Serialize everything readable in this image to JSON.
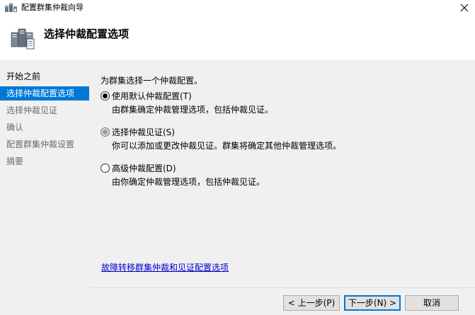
{
  "window": {
    "title": "配置群集仲裁向导",
    "close_glyph": "✕"
  },
  "header": {
    "heading": "选择仲裁配置选项"
  },
  "sidebar": {
    "items": [
      {
        "label": "开始之前",
        "state": "done"
      },
      {
        "label": "选择仲裁配置选项",
        "state": "active"
      },
      {
        "label": "选择仲裁见证",
        "state": "pending"
      },
      {
        "label": "确认",
        "state": "pending"
      },
      {
        "label": "配置群集仲裁设置",
        "state": "pending"
      },
      {
        "label": "摘要",
        "state": "pending"
      }
    ]
  },
  "main": {
    "prompt": "为群集选择一个仲裁配置。",
    "options": [
      {
        "label": "使用默认仲裁配置(T)",
        "description": "由群集确定仲裁管理选项，包括仲裁见证。",
        "selected": true
      },
      {
        "label": "选择仲裁见证(S)",
        "description": "你可以添加或更改仲裁见证。群集将确定其他仲裁管理选项。",
        "selected": false
      },
      {
        "label": "高级仲裁配置(D)",
        "description": "由你确定仲裁管理选项，包括仲裁见证。",
        "selected": false
      }
    ],
    "link": "故障转移群集仲裁和见证配置选项"
  },
  "footer": {
    "back_label": "< 上一步(P)",
    "next_label": "下一步(N) >",
    "cancel_label": "取消"
  },
  "colors": {
    "accent": "#0078d7",
    "link": "#0000cc",
    "panel": "#f0f0f0"
  }
}
